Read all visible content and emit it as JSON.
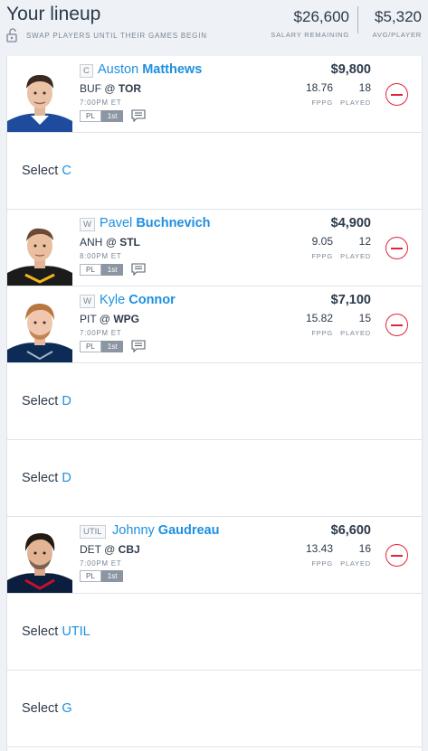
{
  "header": {
    "title": "Your lineup",
    "subtitle": "SWAP PLAYERS UNTIL THEIR GAMES BEGIN",
    "salary_remaining": "$26,600",
    "salary_remaining_label": "SALARY REMAINING",
    "avg_player": "$5,320",
    "avg_player_label": "AVG/PLAYER"
  },
  "labels": {
    "fppg": "FPPG",
    "played": "PLAYED",
    "select": "Select"
  },
  "players": [
    {
      "position": "C",
      "first": "Auston",
      "last": "Matthews",
      "away": "BUF",
      "home": "TOR",
      "at": "@",
      "time": "7:00PM ET",
      "tag1": "PL",
      "tag2": "1st",
      "salary": "$9,800",
      "fppg": "18.76",
      "played": "18",
      "jersey_color": "#1e4b9b"
    },
    {
      "position": "W",
      "first": "Pavel",
      "last": "Buchnevich",
      "away": "ANH",
      "home": "STL",
      "at": "@",
      "time": "8:00PM ET",
      "tag1": "PL",
      "tag2": "1st",
      "salary": "$4,900",
      "fppg": "9.05",
      "played": "12",
      "jersey_color": "#1b1b1b"
    },
    {
      "position": "W",
      "first": "Kyle",
      "last": "Connor",
      "away": "PIT",
      "home": "WPG",
      "at": "@",
      "time": "7:00PM ET",
      "tag1": "PL",
      "tag2": "1st",
      "salary": "$7,100",
      "fppg": "15.82",
      "played": "15",
      "jersey_color": "#0c2c56"
    },
    {
      "position": "UTIL",
      "first": "Johnny",
      "last": "Gaudreau",
      "away": "DET",
      "home": "CBJ",
      "at": "@",
      "time": "7:00PM ET",
      "tag1": "PL",
      "tag2": "1st",
      "salary": "$6,600",
      "fppg": "13.43",
      "played": "16",
      "jersey_color": "#0b1e3d"
    }
  ],
  "empty_slots": [
    {
      "position": "C"
    },
    {
      "position": "D"
    },
    {
      "position": "D"
    },
    {
      "position": "UTIL"
    },
    {
      "position": "G"
    }
  ]
}
